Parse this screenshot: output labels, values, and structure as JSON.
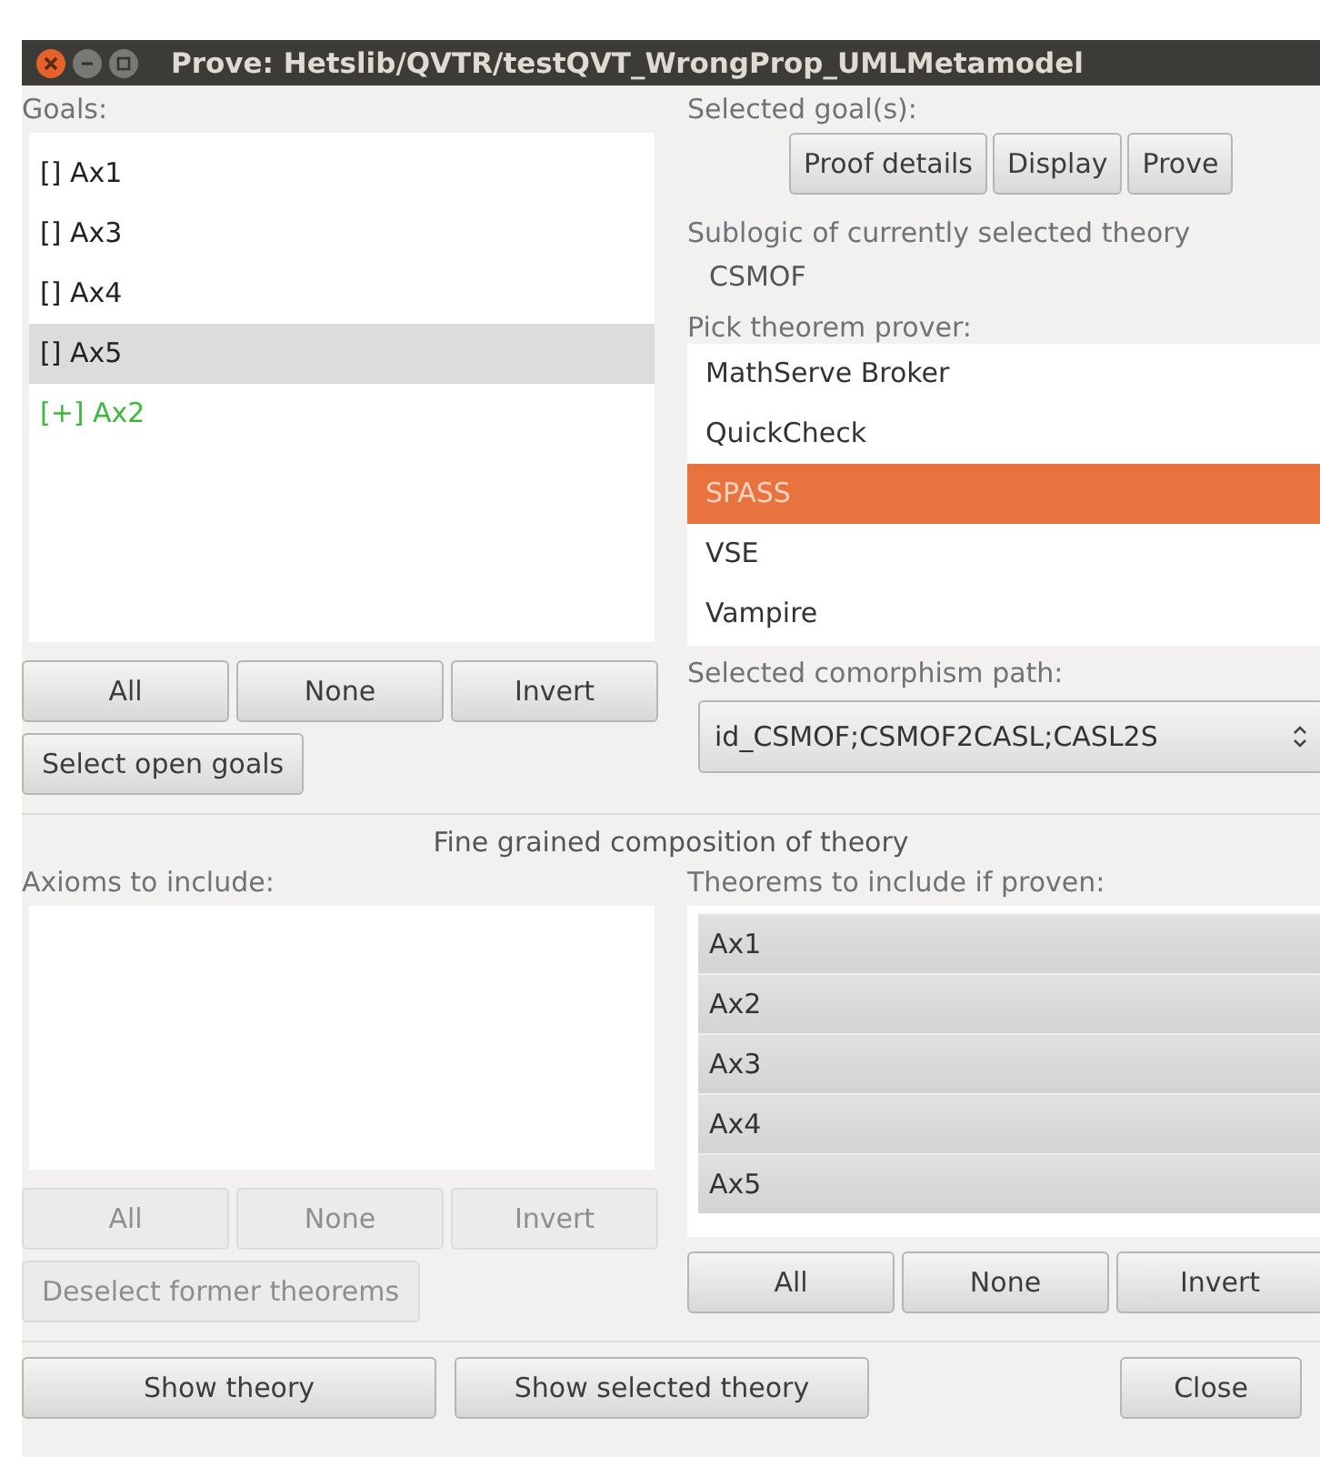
{
  "window": {
    "title": "Prove: Hetslib/QVTR/testQVT_WrongProp_UMLMetamodel"
  },
  "goals": {
    "label": "Goals:",
    "items": [
      {
        "text": "[] Ax1",
        "selected": false,
        "color": "#222222"
      },
      {
        "text": "[] Ax3",
        "selected": false,
        "color": "#222222"
      },
      {
        "text": "[] Ax4",
        "selected": false,
        "color": "#222222"
      },
      {
        "text": "[] Ax5",
        "selected": true,
        "color": "#222222"
      },
      {
        "text": "[+] Ax2",
        "selected": false,
        "color": "#3cb93c"
      }
    ],
    "buttons": [
      {
        "label": "All",
        "disabled": false
      },
      {
        "label": "None",
        "disabled": false
      },
      {
        "label": "Invert",
        "disabled": false
      }
    ],
    "select_open_button": {
      "label": "Select open goals",
      "disabled": false
    }
  },
  "selected_goals": {
    "label": "Selected goal(s):",
    "buttons": [
      "Proof details",
      "Display",
      "Prove"
    ]
  },
  "sublogic": {
    "label": "Sublogic of currently selected theory",
    "value": "CSMOF"
  },
  "provers": {
    "label": "Pick theorem prover:",
    "items": [
      {
        "text": "MathServe Broker",
        "selected": false
      },
      {
        "text": "QuickCheck",
        "selected": false
      },
      {
        "text": "SPASS",
        "selected": true
      },
      {
        "text": "VSE",
        "selected": false
      },
      {
        "text": "Vampire",
        "selected": false
      }
    ]
  },
  "comorphism": {
    "label": "Selected comorphism path:",
    "value": "id_CSMOF;CSMOF2CASL;CASL2S"
  },
  "composition": {
    "title": "Fine grained composition of theory",
    "axioms": {
      "label": "Axioms to include:",
      "buttons": [
        {
          "label": "All",
          "disabled": true
        },
        {
          "label": "None",
          "disabled": true
        },
        {
          "label": "Invert",
          "disabled": true
        }
      ],
      "deselect_button": {
        "label": "Deselect former theorems",
        "disabled": true
      }
    },
    "theorems": {
      "label": "Theorems to include if proven:",
      "items": [
        {
          "text": "Ax1",
          "selected": true
        },
        {
          "text": "Ax2",
          "selected": true
        },
        {
          "text": "Ax3",
          "selected": true
        },
        {
          "text": "Ax4",
          "selected": true
        },
        {
          "text": "Ax5",
          "selected": true
        }
      ],
      "buttons": [
        {
          "label": "All",
          "disabled": false
        },
        {
          "label": "None",
          "disabled": false
        },
        {
          "label": "Invert",
          "disabled": false
        }
      ]
    }
  },
  "footer_buttons": [
    "Show theory",
    "Show selected theory",
    "Close"
  ]
}
